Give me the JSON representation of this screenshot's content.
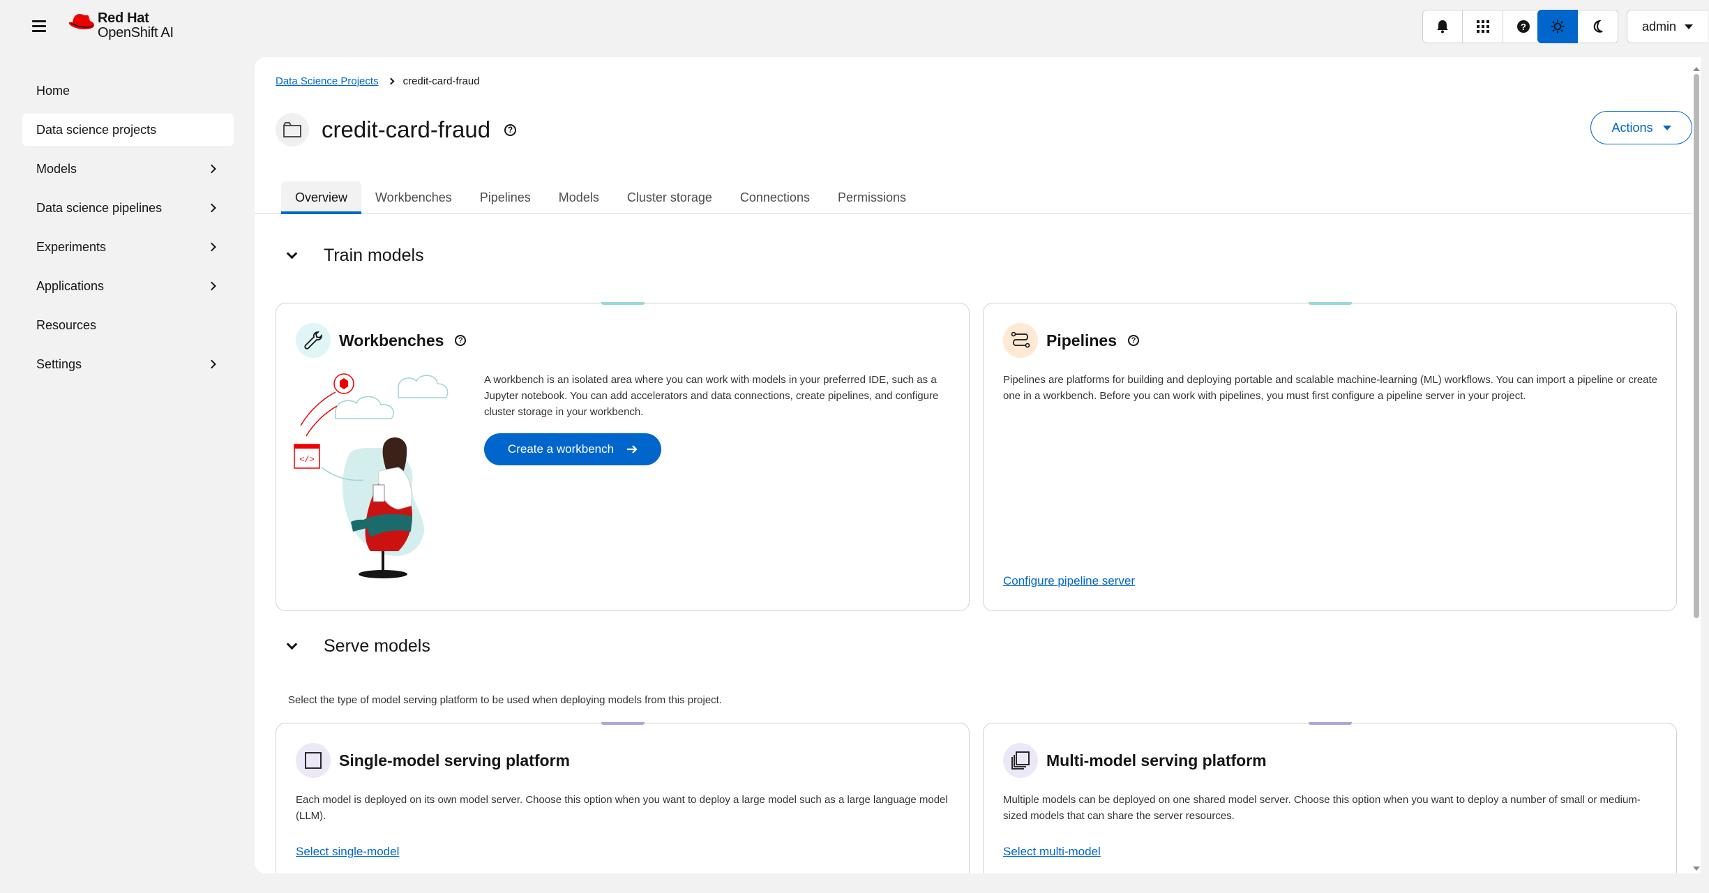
{
  "brand": {
    "line1": "Red Hat",
    "line2": "OpenShift AI"
  },
  "masthead": {
    "icons": [
      "bell-icon",
      "grid-icon",
      "help-icon",
      "sun-icon",
      "moon-icon"
    ],
    "user": "admin"
  },
  "sidebar": {
    "items": [
      {
        "label": "Home",
        "expandable": false,
        "active": false
      },
      {
        "label": "Data science projects",
        "expandable": false,
        "active": true
      },
      {
        "label": "Models",
        "expandable": true,
        "active": false
      },
      {
        "label": "Data science pipelines",
        "expandable": true,
        "active": false
      },
      {
        "label": "Experiments",
        "expandable": true,
        "active": false
      },
      {
        "label": "Applications",
        "expandable": true,
        "active": false
      },
      {
        "label": "Resources",
        "expandable": false,
        "active": false
      },
      {
        "label": "Settings",
        "expandable": true,
        "active": false
      }
    ]
  },
  "breadcrumb": {
    "parent": "Data Science Projects",
    "current": "credit-card-fraud"
  },
  "project": {
    "title": "credit-card-fraud",
    "actions_label": "Actions"
  },
  "tabs": [
    "Overview",
    "Workbenches",
    "Pipelines",
    "Models",
    "Cluster storage",
    "Connections",
    "Permissions"
  ],
  "train": {
    "title": "Train models",
    "workbenches": {
      "title": "Workbenches",
      "description": "A workbench is an isolated area where you can work with models in your preferred IDE, such as a Jupyter notebook. You can add accelerators and data connections, create pipelines, and configure cluster storage in your workbench.",
      "button": "Create a workbench"
    },
    "pipelines": {
      "title": "Pipelines",
      "description": "Pipelines are platforms for building and deploying portable and scalable machine-learning (ML) workflows. You can import a pipeline or create one in a workbench. Before you can work with pipelines, you must first configure a pipeline server in your project.",
      "link": "Configure pipeline server"
    }
  },
  "serve": {
    "title": "Serve models",
    "description": "Select the type of model serving platform to be used when deploying models from this project.",
    "single": {
      "title": "Single-model serving platform",
      "description": "Each model is deployed on its own model server. Choose this option when you want to deploy a large model such as a large language model (LLM).",
      "link": "Select single-model"
    },
    "multi": {
      "title": "Multi-model serving platform",
      "description": "Multiple models can be deployed on one shared model server. Choose this option when you want to deploy a number of small or medium-sized models that can share the server resources.",
      "link": "Select multi-model"
    }
  },
  "colors": {
    "accent": "#0066cc",
    "train_tab": "#9ad8d8",
    "serve_tab": "#b2a3e0",
    "pipeline_icon_bg": "#fde9d4"
  }
}
